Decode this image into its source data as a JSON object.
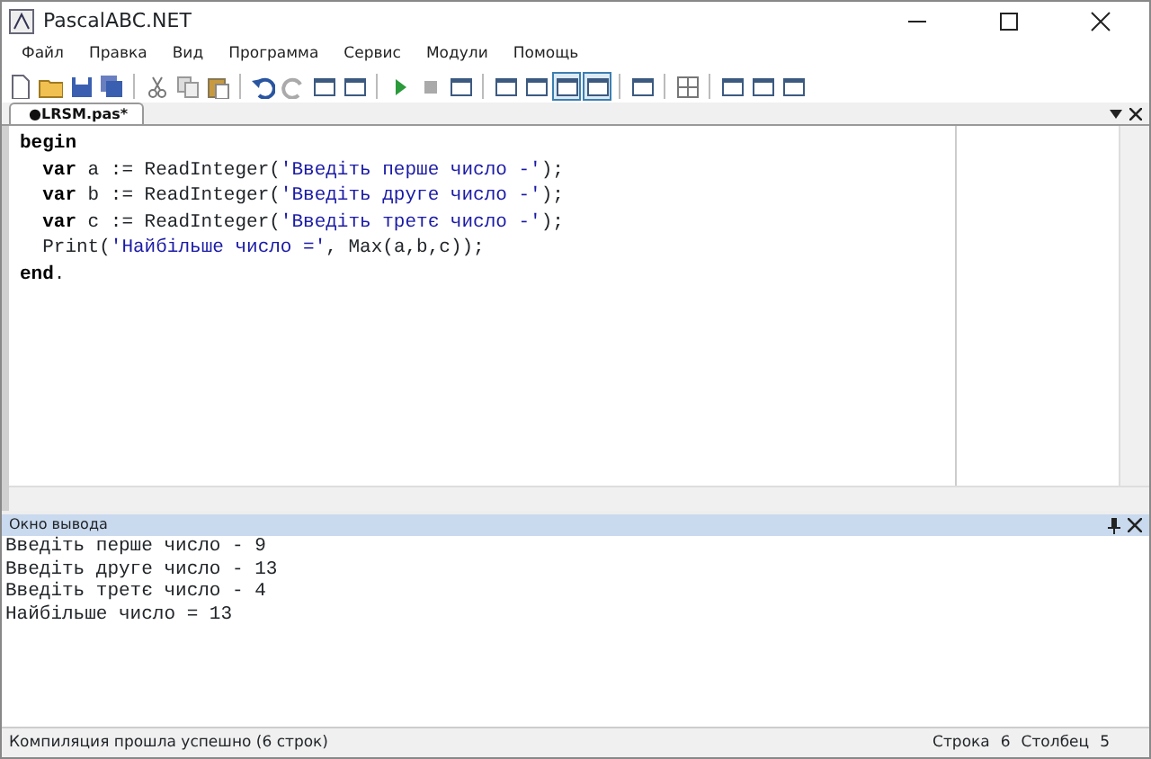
{
  "window": {
    "title": "PascalABC.NET"
  },
  "menu": [
    "Файл",
    "Правка",
    "Вид",
    "Программа",
    "Сервис",
    "Модули",
    "Помощь"
  ],
  "toolbar": [
    {
      "kind": "page",
      "pressed": false
    },
    {
      "kind": "folder",
      "pressed": false
    },
    {
      "kind": "disk",
      "pressed": false
    },
    {
      "kind": "disks",
      "pressed": false
    },
    {
      "kind": "sep"
    },
    {
      "kind": "scissors",
      "pressed": false
    },
    {
      "kind": "copy",
      "pressed": false
    },
    {
      "kind": "paste",
      "pressed": false
    },
    {
      "kind": "sep"
    },
    {
      "kind": "undo",
      "pressed": false
    },
    {
      "kind": "redo",
      "pressed": false
    },
    {
      "kind": "window",
      "pressed": false
    },
    {
      "kind": "window",
      "pressed": false
    },
    {
      "kind": "sep"
    },
    {
      "kind": "play",
      "pressed": false
    },
    {
      "kind": "stop",
      "pressed": false
    },
    {
      "kind": "window",
      "pressed": false
    },
    {
      "kind": "sep"
    },
    {
      "kind": "window",
      "pressed": false
    },
    {
      "kind": "window",
      "pressed": false
    },
    {
      "kind": "window",
      "pressed": true
    },
    {
      "kind": "window",
      "pressed": true
    },
    {
      "kind": "sep"
    },
    {
      "kind": "window",
      "pressed": false
    },
    {
      "kind": "sep"
    },
    {
      "kind": "grid",
      "pressed": false
    },
    {
      "kind": "sep"
    },
    {
      "kind": "window",
      "pressed": false
    },
    {
      "kind": "window",
      "pressed": false
    },
    {
      "kind": "window",
      "pressed": false
    }
  ],
  "tabs": [
    {
      "label": "●LRSM.pas*",
      "selected": true
    }
  ],
  "editor": {
    "lines": [
      {
        "tokens": [
          {
            "kind": "keyword",
            "text": "begin"
          }
        ],
        "children": [
          {
            "tokens": [
              {
                "kind": "keyword",
                "text": "var"
              },
              {
                "kind": "plain",
                "text": " a := ReadInteger("
              },
              {
                "kind": "string",
                "text": "'Введіть перше число -'"
              },
              {
                "kind": "plain",
                "text": ");"
              }
            ]
          },
          {
            "tokens": [
              {
                "kind": "keyword",
                "text": "var"
              },
              {
                "kind": "plain",
                "text": " b := ReadInteger("
              },
              {
                "kind": "string",
                "text": "'Введіть друге число -'"
              },
              {
                "kind": "plain",
                "text": ");"
              }
            ]
          },
          {
            "tokens": [
              {
                "kind": "keyword",
                "text": "var"
              },
              {
                "kind": "plain",
                "text": " c := ReadInteger("
              },
              {
                "kind": "string",
                "text": "'Введіть третє число -'"
              },
              {
                "kind": "plain",
                "text": ");"
              }
            ]
          },
          {
            "tokens": [
              {
                "kind": "plain",
                "text": "Print("
              },
              {
                "kind": "string",
                "text": "'Найбільше число ='"
              },
              {
                "kind": "plain",
                "text": ", Max(a,b,c));"
              }
            ]
          }
        ]
      },
      {
        "tokens": [
          {
            "kind": "keyword",
            "text": "end"
          },
          {
            "kind": "plain",
            "text": "."
          }
        ]
      }
    ]
  },
  "output": {
    "title": "Окно вывода",
    "lines": [
      "Введіть перше число - 9",
      "Введіть друге число - 13",
      "Введіть третє число - 4",
      "Найбільше число = 13"
    ]
  },
  "status_bar": {
    "message": "Компиляция прошла успешно (6 строк)",
    "line_label": "Строка",
    "line": "6",
    "column_label": "Столбец",
    "column": "5"
  }
}
